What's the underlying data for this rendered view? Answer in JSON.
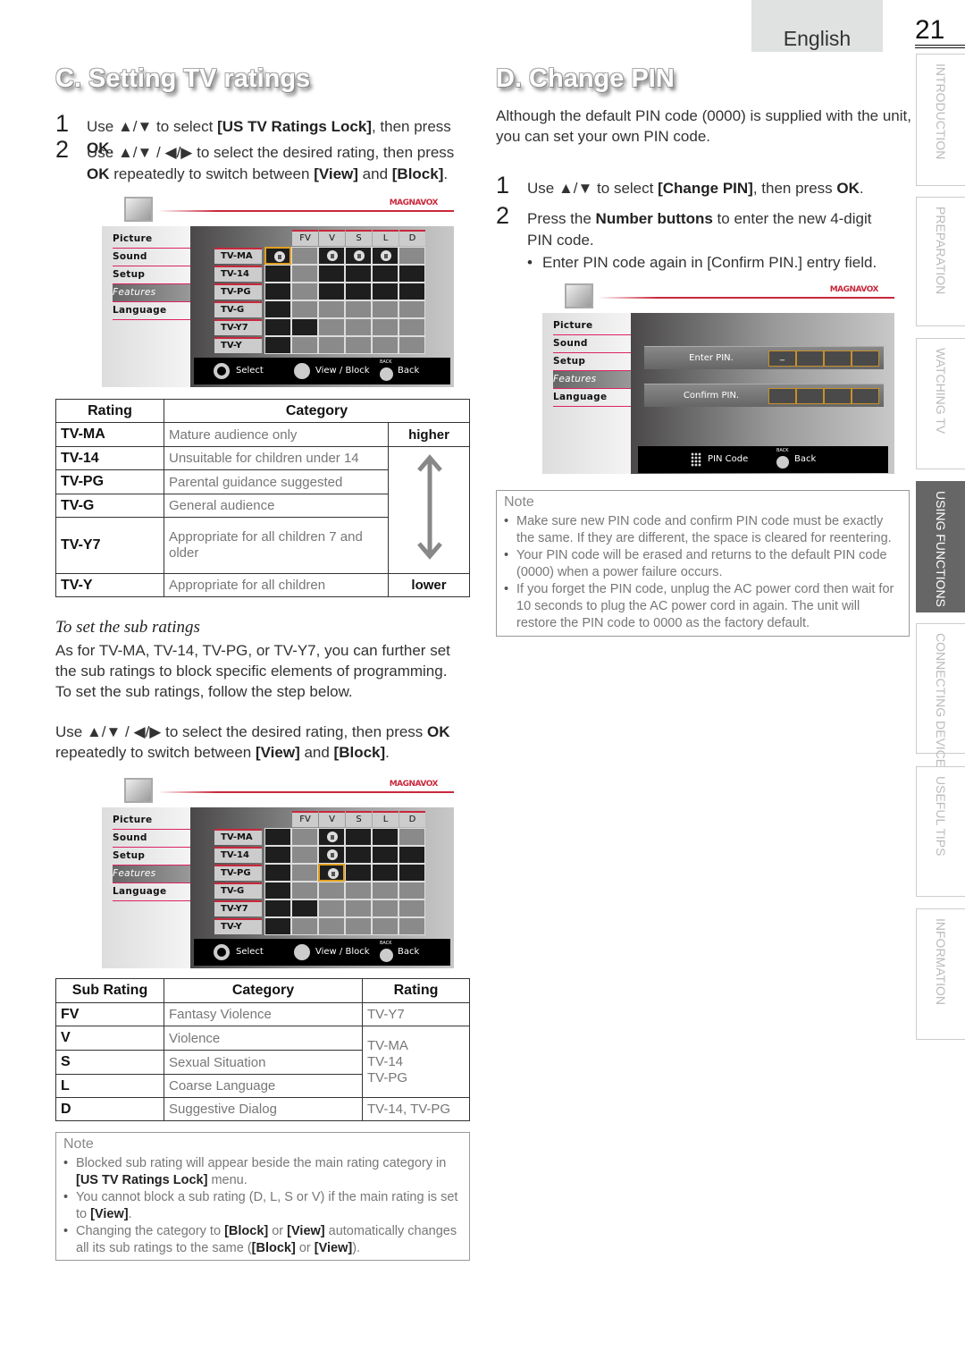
{
  "header": {
    "language": "English",
    "page_number": "21"
  },
  "side_tabs": [
    {
      "label": "INTRODUCTION",
      "active": false
    },
    {
      "label": "PREPARATION",
      "active": false
    },
    {
      "label": "WATCHING TV",
      "active": false
    },
    {
      "label": "USING FUNCTIONS",
      "active": true
    },
    {
      "label": "CONNECTING DEVICES",
      "active": false
    },
    {
      "label": "USEFUL TIPS",
      "active": false
    },
    {
      "label": "INFORMATION",
      "active": false
    }
  ],
  "section_c": {
    "title": "C. Setting TV ratings",
    "steps": [
      {
        "num": "1",
        "text": "Use ▲/▼ to select [US TV Ratings Lock], then press OK."
      },
      {
        "num": "2",
        "text": "Use ▲/▼ / ◀/▶ to select the desired rating, then press OK repeatedly to switch between [View] and [Block]."
      }
    ],
    "rating_table": {
      "headers": [
        "Rating",
        "Category"
      ],
      "rows": [
        {
          "rating": "TV-MA",
          "category": "Mature audience only"
        },
        {
          "rating": "TV-14",
          "category": "Unsuitable for children under 14"
        },
        {
          "rating": "TV-PG",
          "category": "Parental guidance suggested"
        },
        {
          "rating": "TV-G",
          "category": "General audience"
        },
        {
          "rating": "TV-Y7",
          "category": "Appropriate for all children 7 and older"
        },
        {
          "rating": "TV-Y",
          "category": "Appropriate for all children"
        }
      ],
      "higher": "higher",
      "lower": "lower"
    },
    "sub_title": "To set the sub ratings",
    "sub_paragraph": "As for TV-MA, TV-14, TV-PG, or TV-Y7, you can further set the sub ratings to block specific elements of programming. To set the sub ratings, follow the step below.",
    "sub_step": "Use ▲/▼ / ◀/▶ to select the desired rating, then press OK repeatedly to switch between [View] and [Block].",
    "sub_table": {
      "headers": [
        "Sub Rating",
        "Category",
        "Rating"
      ],
      "rows": [
        {
          "sub": "FV",
          "category": "Fantasy Violence"
        },
        {
          "sub": "V",
          "category": "Violence"
        },
        {
          "sub": "S",
          "category": "Sexual Situation"
        },
        {
          "sub": "L",
          "category": "Coarse Language"
        },
        {
          "sub": "D",
          "category": "Suggestive Dialog"
        }
      ],
      "rating_fv": "TV-Y7",
      "rating_vsl": [
        "TV-MA",
        "TV-14",
        "TV-PG"
      ],
      "rating_d": "TV-14, TV-PG"
    },
    "note": {
      "title": "Note",
      "items": [
        "Blocked sub rating will appear beside the main rating category in [US TV Ratings Lock] menu.",
        "You cannot block a sub rating (D, L, S or V) if the main rating is set to [View].",
        "Changing the category to [Block] or [View] automatically changes all its sub ratings to the same ([Block] or [View])."
      ]
    }
  },
  "section_d": {
    "title": "D. Change PIN",
    "intro": "Although the default PIN code (0000) is supplied with the unit, you can set your own PIN code.",
    "steps": [
      {
        "num": "1",
        "text": "Use ▲/▼ to select [Change PIN], then press OK."
      },
      {
        "num": "2",
        "text": "Press the Number buttons to enter the new 4-digit PIN code."
      }
    ],
    "sub_bullet": "Enter PIN code again in [Confirm PIN.] entry field.",
    "note": {
      "title": "Note",
      "items": [
        "Make sure new PIN code and confirm PIN code must be exactly the same. If they are different, the space is cleared for reentering.",
        "Your PIN code will be erased and returns to the default PIN code (0000) when a power failure occurs.",
        "If you forget the PIN code, unplug the AC power cord then wait for 10 seconds to plug the AC power cord in again. The unit will restore the PIN code to 0000 as the factory default."
      ]
    }
  },
  "tv_common": {
    "logo": "MAGNAVOX",
    "menu": [
      "Picture",
      "Sound",
      "Setup",
      "Features",
      "Language"
    ],
    "selected_menu": "Features",
    "sub_columns": [
      "FV",
      "V",
      "S",
      "L",
      "D"
    ],
    "ratings": [
      "TV-MA",
      "TV-14",
      "TV-PG",
      "TV-G",
      "TV-Y7",
      "TV-Y"
    ],
    "select_label": "Select",
    "viewblock_label": "View / Block",
    "back_label": "Back",
    "back_small": "BACK",
    "ok_small": "OK"
  },
  "tv_screen_1": {
    "grid": [
      [
        "L*",
        "g",
        "L",
        "L",
        "L",
        "g"
      ],
      [
        "d",
        "g",
        "d",
        "d",
        "d",
        "d"
      ],
      [
        "d",
        "g",
        "d",
        "d",
        "d",
        "d"
      ],
      [
        "d",
        "g",
        "g",
        "g",
        "g",
        "g"
      ],
      [
        "d",
        "d",
        "g",
        "g",
        "g",
        "g"
      ],
      [
        "d",
        "g",
        "g",
        "g",
        "g",
        "g"
      ]
    ]
  },
  "tv_screen_2": {
    "grid": [
      [
        "d",
        "g",
        "L",
        "d",
        "d",
        "g"
      ],
      [
        "d",
        "g",
        "L",
        "d",
        "d",
        "d"
      ],
      [
        "d",
        "g",
        "L*",
        "d",
        "d",
        "d"
      ],
      [
        "d",
        "g",
        "g",
        "g",
        "g",
        "g"
      ],
      [
        "d",
        "d",
        "g",
        "g",
        "g",
        "g"
      ],
      [
        "d",
        "g",
        "g",
        "g",
        "g",
        "g"
      ]
    ]
  },
  "tv_screen_pin": {
    "enter_label": "Enter PIN.",
    "enter_value": "_",
    "confirm_label": "Confirm PIN.",
    "pin_code_label": "PIN Code",
    "back_label": "Back"
  }
}
